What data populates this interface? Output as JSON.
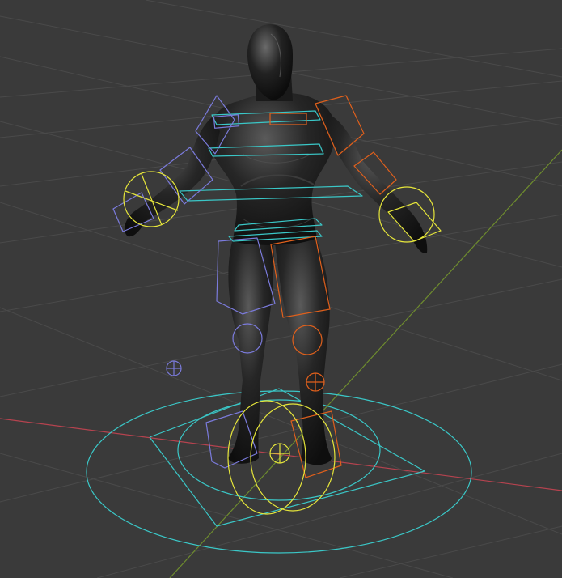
{
  "app": {
    "name": "3D viewport",
    "mode": "pose-mode"
  },
  "scene": {
    "background_color": "#3a3a3a",
    "grid_color": "#4a4a4a",
    "x_axis_color": "#b6434f",
    "y_axis_color": "#6e8c2e",
    "object": "humanoid-mannequin",
    "object_color": "#1c1c1c",
    "rig_colors": {
      "root_cyan": "#3ac7c7",
      "left_side_blue": "#7b7bdc",
      "right_side_orange": "#e0601c",
      "ik_yellow": "#e6e63a"
    }
  }
}
